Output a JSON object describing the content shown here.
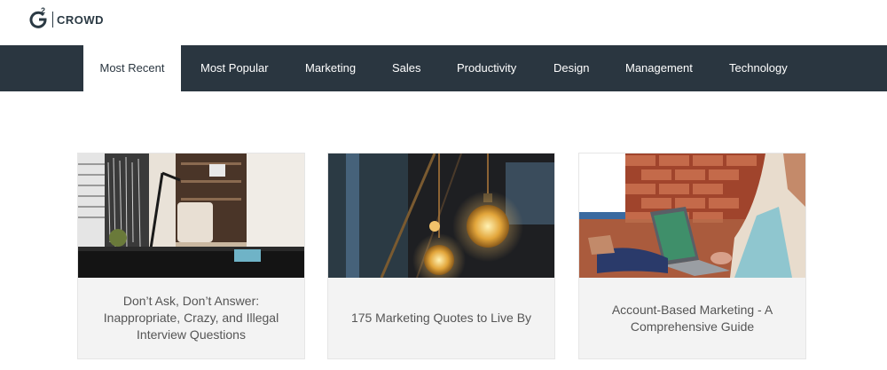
{
  "logo": {
    "sup": "2",
    "text": "CROWD"
  },
  "nav": {
    "items": [
      {
        "label": "Most Recent",
        "active": true
      },
      {
        "label": "Most Popular"
      },
      {
        "label": "Marketing"
      },
      {
        "label": "Sales"
      },
      {
        "label": "Productivity"
      },
      {
        "label": "Design"
      },
      {
        "label": "Management"
      },
      {
        "label": "Technology"
      }
    ]
  },
  "cards": [
    {
      "title": "Don’t Ask, Don’t Answer: Inappropriate, Crazy, and Illegal Interview Questions",
      "image": "office-desk-with-lamp-photo"
    },
    {
      "title": "175 Marketing Quotes to Live By",
      "image": "hanging-light-bulbs-photo"
    },
    {
      "title": "Account-Based Marketing - A Comprehensive Guide",
      "image": "laptop-brick-wall-photo"
    }
  ],
  "colors": {
    "nav_bg": "#2a3640",
    "nav_text": "#ffffff",
    "active_bg": "#ffffff",
    "card_bg": "#f3f3f3"
  }
}
